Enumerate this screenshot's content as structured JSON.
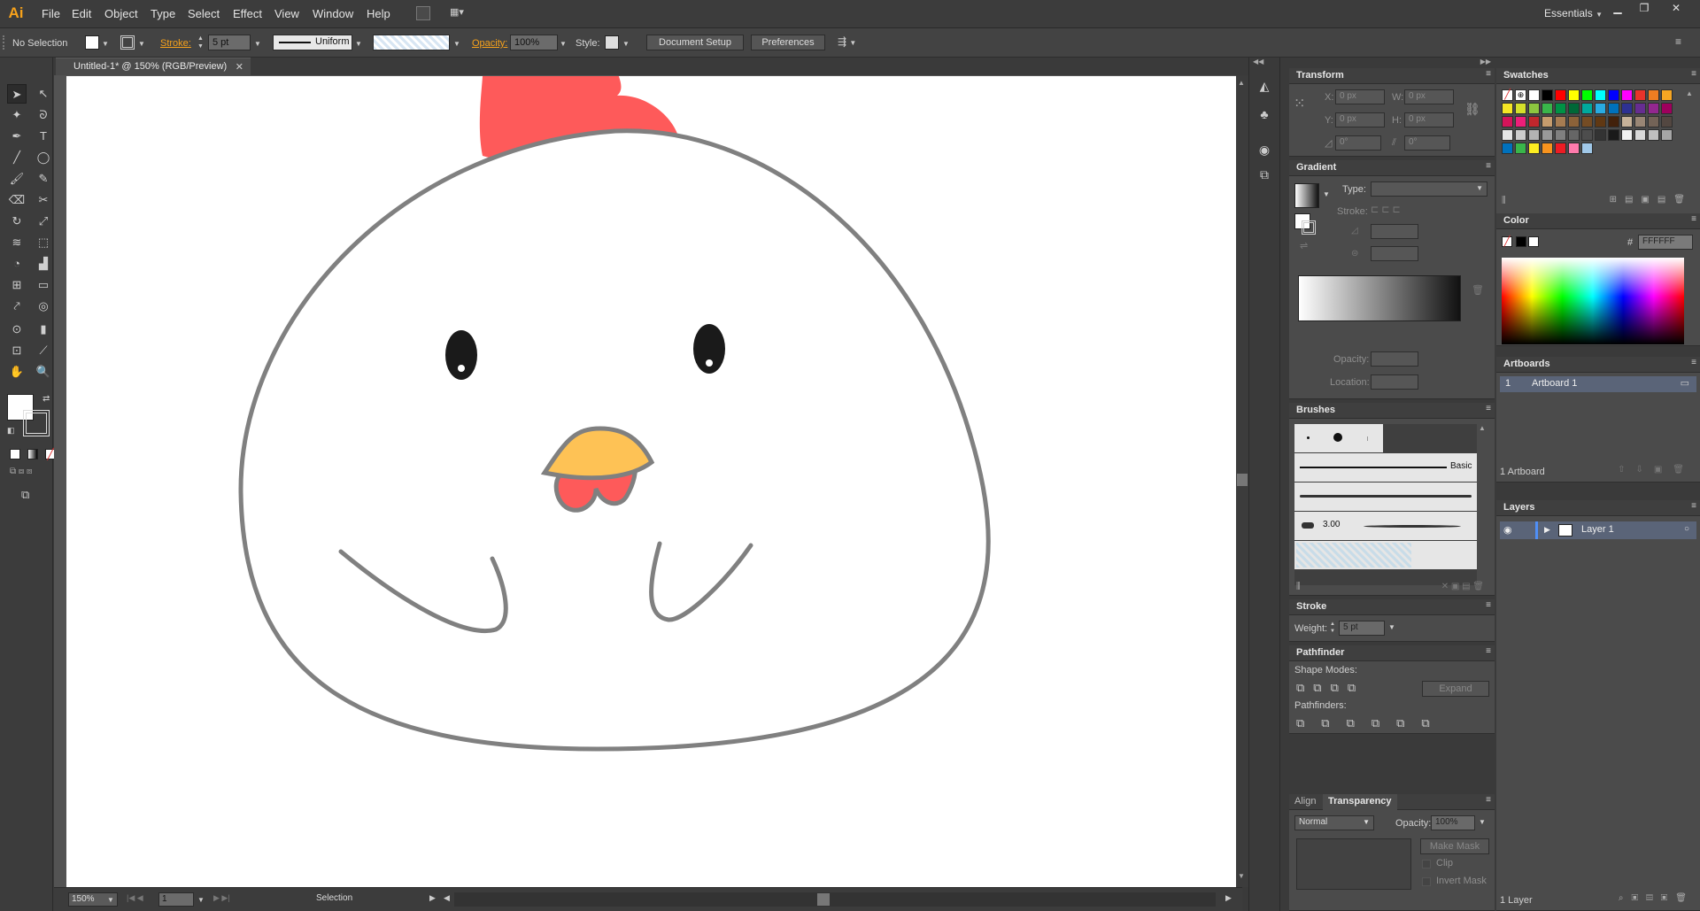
{
  "app": {
    "logo": "Ai",
    "workspace": "Essentials"
  },
  "menu": [
    "File",
    "Edit",
    "Object",
    "Type",
    "Select",
    "Effect",
    "View",
    "Window",
    "Help"
  ],
  "control_bar": {
    "selection": "No Selection",
    "stroke_label": "Stroke:",
    "stroke_value": "5 pt",
    "profile": "Uniform",
    "opacity_label": "Opacity:",
    "opacity_value": "100%",
    "style_label": "Style:",
    "document_setup": "Document Setup",
    "preferences": "Preferences"
  },
  "document": {
    "tab_title": "Untitled-1* @ 150% (RGB/Preview)"
  },
  "status_bar": {
    "zoom": "150%",
    "artboard_num": "1",
    "tool": "Selection"
  },
  "transform": {
    "title": "Transform",
    "x_label": "X:",
    "x": "0 px",
    "y_label": "Y:",
    "y": "0 px",
    "w_label": "W:",
    "w": "0 px",
    "h_label": "H:",
    "h": "0 px",
    "rotate": "0°",
    "shear": "0°"
  },
  "gradient": {
    "title": "Gradient",
    "type_label": "Type:",
    "stroke_label": "Stroke:",
    "opacity_label": "Opacity:",
    "location_label": "Location:"
  },
  "brushes": {
    "title": "Brushes",
    "basic_label": "Basic",
    "size_label": "3.00"
  },
  "stroke_panel": {
    "title": "Stroke",
    "weight_label": "Weight:",
    "weight": "5 pt"
  },
  "pathfinder": {
    "title": "Pathfinder",
    "shape_modes": "Shape Modes:",
    "expand": "Expand",
    "pathfinders": "Pathfinders:"
  },
  "transparency": {
    "tab_align": "Align",
    "tab_transparency": "Transparency",
    "blend_mode": "Normal",
    "opacity_label": "Opacity:",
    "opacity": "100%",
    "make_mask": "Make Mask",
    "clip": "Clip",
    "invert_mask": "Invert Mask"
  },
  "swatches": {
    "title": "Swatches"
  },
  "color": {
    "title": "Color",
    "hash": "#",
    "hex": "FFFFFF"
  },
  "artboards": {
    "title": "Artboards",
    "rows": [
      {
        "num": "1",
        "name": "Artboard 1"
      }
    ],
    "footer": "1 Artboard"
  },
  "layers": {
    "title": "Layers",
    "rows": [
      {
        "name": "Layer 1"
      }
    ],
    "footer": "1 Layer"
  },
  "colors": {
    "comb": "#fe5a5a",
    "beak": "#fec255",
    "wattle": "#fe5a5a",
    "outline": "#808080",
    "eye": "#1a1a1a",
    "accent": "#f7a21b"
  }
}
